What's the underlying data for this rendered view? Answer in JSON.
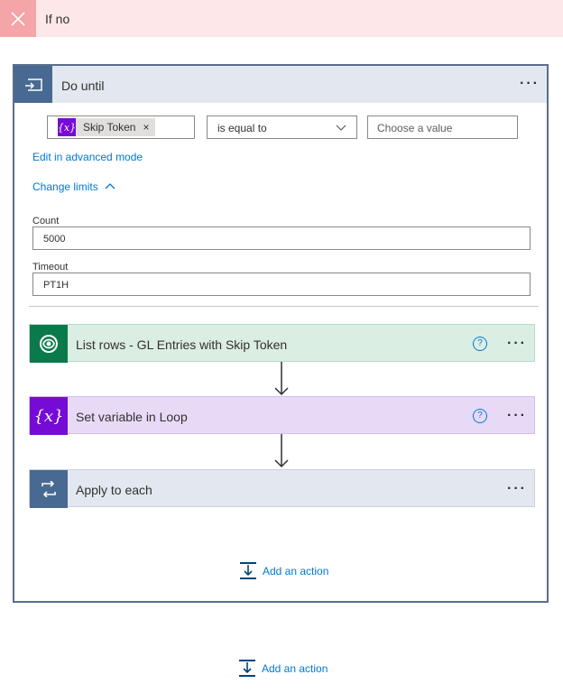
{
  "if_no": {
    "title": "If no",
    "icon": "close-icon"
  },
  "do_until": {
    "title": "Do until",
    "more": "···",
    "condition": {
      "token_label": "Skip Token",
      "token_remove": "×",
      "token_icon_text": "{x}",
      "operator": "is equal to",
      "value_placeholder": "Choose a value"
    },
    "advanced_link": "Edit in advanced mode",
    "change_limits_link": "Change limits",
    "count_label": "Count",
    "count_value": "5000",
    "timeout_label": "Timeout",
    "timeout_value": "PT1H",
    "steps": [
      {
        "title": "List rows - GL Entries with Skip Token",
        "icon": "dataverse-icon",
        "help": "?",
        "more": "···",
        "color": "#0b7a4b",
        "bg": "#dbeee4"
      },
      {
        "title": "Set variable in Loop",
        "icon": "variable-icon",
        "icon_text": "{x}",
        "help": "?",
        "more": "···",
        "color": "#770bd6",
        "bg": "#e8daf7"
      },
      {
        "title": "Apply to each",
        "icon": "loop-icon",
        "more": "···",
        "color": "#486991",
        "bg": "#e3e8f0"
      }
    ],
    "add_action": "Add an action"
  },
  "add_action_outer": "Add an action",
  "colors": {
    "link": "#0078d4",
    "ifno_bg": "#fde7e9",
    "ifno_icon_bg": "#f3a5a7",
    "dountil_head": "#e3e8f0",
    "dountil_icon": "#486991"
  }
}
